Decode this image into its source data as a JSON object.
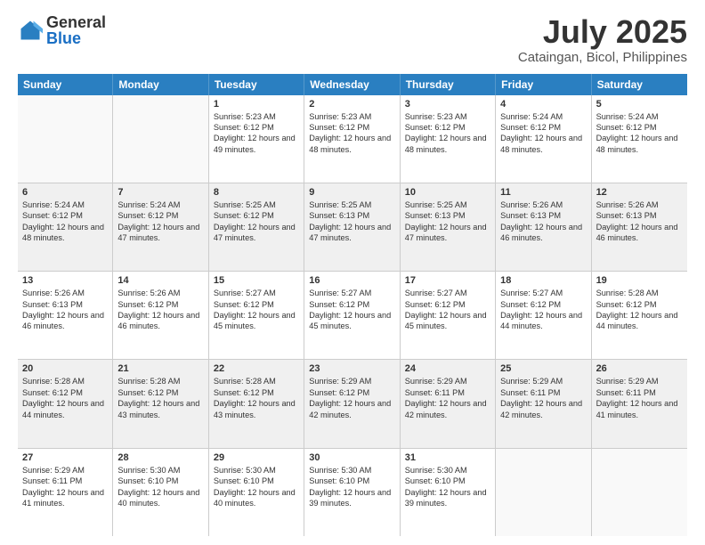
{
  "logo": {
    "general": "General",
    "blue": "Blue"
  },
  "title": "July 2025",
  "subtitle": "Cataingan, Bicol, Philippines",
  "header_days": [
    "Sunday",
    "Monday",
    "Tuesday",
    "Wednesday",
    "Thursday",
    "Friday",
    "Saturday"
  ],
  "weeks": [
    [
      {
        "day": "",
        "sunrise": "",
        "sunset": "",
        "daylight": "",
        "empty": true
      },
      {
        "day": "",
        "sunrise": "",
        "sunset": "",
        "daylight": "",
        "empty": true
      },
      {
        "day": "1",
        "sunrise": "Sunrise: 5:23 AM",
        "sunset": "Sunset: 6:12 PM",
        "daylight": "Daylight: 12 hours and 49 minutes."
      },
      {
        "day": "2",
        "sunrise": "Sunrise: 5:23 AM",
        "sunset": "Sunset: 6:12 PM",
        "daylight": "Daylight: 12 hours and 48 minutes."
      },
      {
        "day": "3",
        "sunrise": "Sunrise: 5:23 AM",
        "sunset": "Sunset: 6:12 PM",
        "daylight": "Daylight: 12 hours and 48 minutes."
      },
      {
        "day": "4",
        "sunrise": "Sunrise: 5:24 AM",
        "sunset": "Sunset: 6:12 PM",
        "daylight": "Daylight: 12 hours and 48 minutes."
      },
      {
        "day": "5",
        "sunrise": "Sunrise: 5:24 AM",
        "sunset": "Sunset: 6:12 PM",
        "daylight": "Daylight: 12 hours and 48 minutes."
      }
    ],
    [
      {
        "day": "6",
        "sunrise": "Sunrise: 5:24 AM",
        "sunset": "Sunset: 6:12 PM",
        "daylight": "Daylight: 12 hours and 48 minutes."
      },
      {
        "day": "7",
        "sunrise": "Sunrise: 5:24 AM",
        "sunset": "Sunset: 6:12 PM",
        "daylight": "Daylight: 12 hours and 47 minutes."
      },
      {
        "day": "8",
        "sunrise": "Sunrise: 5:25 AM",
        "sunset": "Sunset: 6:12 PM",
        "daylight": "Daylight: 12 hours and 47 minutes."
      },
      {
        "day": "9",
        "sunrise": "Sunrise: 5:25 AM",
        "sunset": "Sunset: 6:13 PM",
        "daylight": "Daylight: 12 hours and 47 minutes."
      },
      {
        "day": "10",
        "sunrise": "Sunrise: 5:25 AM",
        "sunset": "Sunset: 6:13 PM",
        "daylight": "Daylight: 12 hours and 47 minutes."
      },
      {
        "day": "11",
        "sunrise": "Sunrise: 5:26 AM",
        "sunset": "Sunset: 6:13 PM",
        "daylight": "Daylight: 12 hours and 46 minutes."
      },
      {
        "day": "12",
        "sunrise": "Sunrise: 5:26 AM",
        "sunset": "Sunset: 6:13 PM",
        "daylight": "Daylight: 12 hours and 46 minutes."
      }
    ],
    [
      {
        "day": "13",
        "sunrise": "Sunrise: 5:26 AM",
        "sunset": "Sunset: 6:13 PM",
        "daylight": "Daylight: 12 hours and 46 minutes."
      },
      {
        "day": "14",
        "sunrise": "Sunrise: 5:26 AM",
        "sunset": "Sunset: 6:12 PM",
        "daylight": "Daylight: 12 hours and 46 minutes."
      },
      {
        "day": "15",
        "sunrise": "Sunrise: 5:27 AM",
        "sunset": "Sunset: 6:12 PM",
        "daylight": "Daylight: 12 hours and 45 minutes."
      },
      {
        "day": "16",
        "sunrise": "Sunrise: 5:27 AM",
        "sunset": "Sunset: 6:12 PM",
        "daylight": "Daylight: 12 hours and 45 minutes."
      },
      {
        "day": "17",
        "sunrise": "Sunrise: 5:27 AM",
        "sunset": "Sunset: 6:12 PM",
        "daylight": "Daylight: 12 hours and 45 minutes."
      },
      {
        "day": "18",
        "sunrise": "Sunrise: 5:27 AM",
        "sunset": "Sunset: 6:12 PM",
        "daylight": "Daylight: 12 hours and 44 minutes."
      },
      {
        "day": "19",
        "sunrise": "Sunrise: 5:28 AM",
        "sunset": "Sunset: 6:12 PM",
        "daylight": "Daylight: 12 hours and 44 minutes."
      }
    ],
    [
      {
        "day": "20",
        "sunrise": "Sunrise: 5:28 AM",
        "sunset": "Sunset: 6:12 PM",
        "daylight": "Daylight: 12 hours and 44 minutes."
      },
      {
        "day": "21",
        "sunrise": "Sunrise: 5:28 AM",
        "sunset": "Sunset: 6:12 PM",
        "daylight": "Daylight: 12 hours and 43 minutes."
      },
      {
        "day": "22",
        "sunrise": "Sunrise: 5:28 AM",
        "sunset": "Sunset: 6:12 PM",
        "daylight": "Daylight: 12 hours and 43 minutes."
      },
      {
        "day": "23",
        "sunrise": "Sunrise: 5:29 AM",
        "sunset": "Sunset: 6:12 PM",
        "daylight": "Daylight: 12 hours and 42 minutes."
      },
      {
        "day": "24",
        "sunrise": "Sunrise: 5:29 AM",
        "sunset": "Sunset: 6:11 PM",
        "daylight": "Daylight: 12 hours and 42 minutes."
      },
      {
        "day": "25",
        "sunrise": "Sunrise: 5:29 AM",
        "sunset": "Sunset: 6:11 PM",
        "daylight": "Daylight: 12 hours and 42 minutes."
      },
      {
        "day": "26",
        "sunrise": "Sunrise: 5:29 AM",
        "sunset": "Sunset: 6:11 PM",
        "daylight": "Daylight: 12 hours and 41 minutes."
      }
    ],
    [
      {
        "day": "27",
        "sunrise": "Sunrise: 5:29 AM",
        "sunset": "Sunset: 6:11 PM",
        "daylight": "Daylight: 12 hours and 41 minutes."
      },
      {
        "day": "28",
        "sunrise": "Sunrise: 5:30 AM",
        "sunset": "Sunset: 6:10 PM",
        "daylight": "Daylight: 12 hours and 40 minutes."
      },
      {
        "day": "29",
        "sunrise": "Sunrise: 5:30 AM",
        "sunset": "Sunset: 6:10 PM",
        "daylight": "Daylight: 12 hours and 40 minutes."
      },
      {
        "day": "30",
        "sunrise": "Sunrise: 5:30 AM",
        "sunset": "Sunset: 6:10 PM",
        "daylight": "Daylight: 12 hours and 39 minutes."
      },
      {
        "day": "31",
        "sunrise": "Sunrise: 5:30 AM",
        "sunset": "Sunset: 6:10 PM",
        "daylight": "Daylight: 12 hours and 39 minutes."
      },
      {
        "day": "",
        "sunrise": "",
        "sunset": "",
        "daylight": "",
        "empty": true
      },
      {
        "day": "",
        "sunrise": "",
        "sunset": "",
        "daylight": "",
        "empty": true
      }
    ]
  ]
}
